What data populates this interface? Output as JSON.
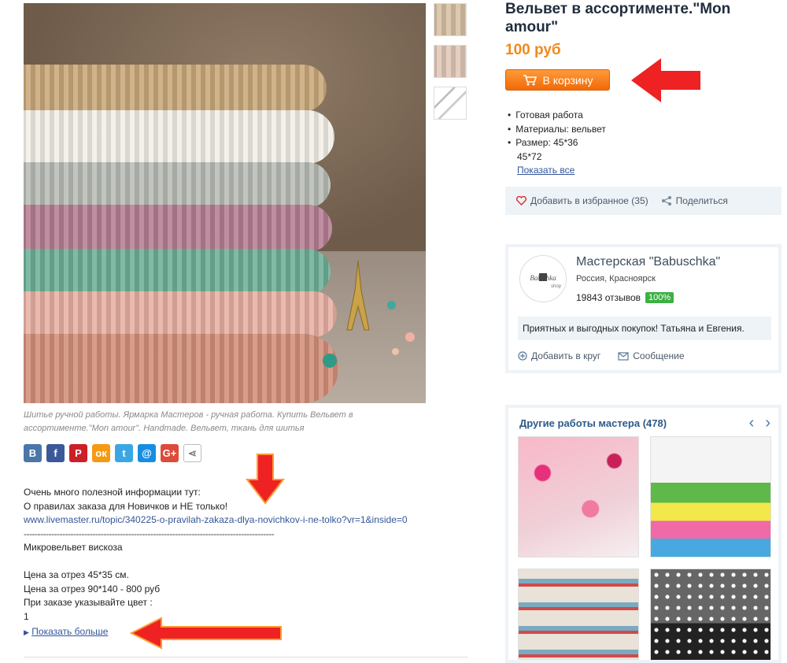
{
  "product": {
    "title": "Вельвет в ассортименте.\"Mon amour\"",
    "price": "100 руб",
    "cart_label": "В корзину",
    "properties": [
      "Готовая работа",
      "Материалы: вельвет",
      "Размер: 45*36"
    ],
    "property_cont": "45*72",
    "show_all": "Показать все"
  },
  "actions": {
    "favorite": "Добавить в избранное (35)",
    "share": "Поделиться"
  },
  "shop": {
    "name": "Мастерская \"Babuschka\"",
    "location": "Россия, Красноярск",
    "reviews": "19843 отзывов",
    "rating": "100%",
    "message": "Приятных и выгодных покупок! Татьяна и Евгения.",
    "add_circle": "Добавить в круг",
    "send_message": "Сообщение",
    "logo_text": "Babuschka shop"
  },
  "caption": "Шитье ручной работы. Ярмарка Мастеров - ручная работа. Купить Вельвет в ассортименте.\"Mon amour\". Handmade. Вельвет, ткань для шитья",
  "socials": [
    {
      "name": "vk-icon",
      "glyph": "В",
      "color": "#4a76a8"
    },
    {
      "name": "facebook-icon",
      "glyph": "f",
      "color": "#3b5998"
    },
    {
      "name": "pinterest-icon",
      "glyph": "P",
      "color": "#cb2027"
    },
    {
      "name": "odnoklassniki-icon",
      "glyph": "ок",
      "color": "#f59a12"
    },
    {
      "name": "twitter-icon",
      "glyph": "t",
      "color": "#3aa7e4"
    },
    {
      "name": "mailru-icon",
      "glyph": "@",
      "color": "#168de2"
    },
    {
      "name": "googleplus-icon",
      "glyph": "G+",
      "color": "#dd4b39"
    },
    {
      "name": "share-icon",
      "glyph": "⋖",
      "color": "#ffffff"
    }
  ],
  "description": {
    "line1": "Очень много полезной информации тут:",
    "line2": "О правилах заказа для Новичков и НЕ только!",
    "link": "www.livemaster.ru/topic/340225-o-pravilah-zakaza-dlya-novichkov-i-ne-tolko?vr=1&inside=0",
    "divider": "-------------------------------------------------------------------------------------------",
    "line3": "Микровельвет вискоза",
    "line4": "Цена за отрез 45*35 см.",
    "line5": "Цена за отрез 90*140 - 800 руб",
    "line6": "При заказе указывайте цвет :",
    "line7": "1",
    "show_more": "Показать больше"
  },
  "other_works": {
    "title": "Другие работы мастера (478)",
    "prev": "‹",
    "next": "›"
  },
  "watermark": "Babuschka"
}
